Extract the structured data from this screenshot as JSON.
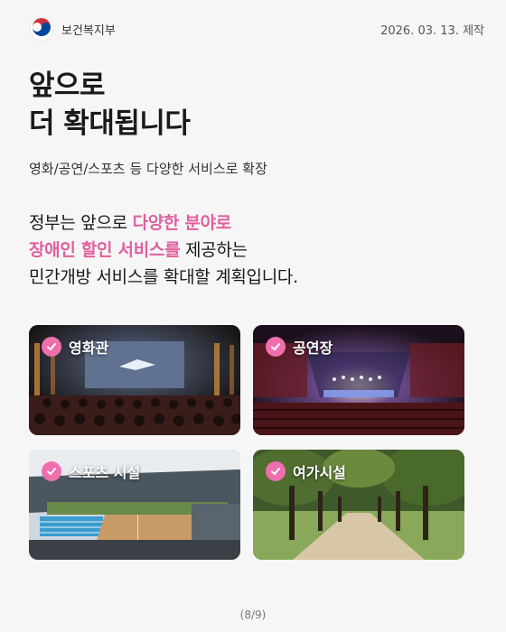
{
  "header": {
    "org_name": "보건복지부",
    "date": "2026. 03. 13. 제작",
    "logo_icon": "taegeuk-emblem-icon"
  },
  "title_lines": [
    "앞으로",
    "더 확대됩니다"
  ],
  "subtitle": "영화/공연/스포츠 등 다양한 서비스로 확장",
  "body": {
    "line1_pre": "정부는 앞으로 ",
    "line1_highlight": "다양한 분야로",
    "line2_highlight": "장애인 할인 서비스를",
    "line2_post": " 제공하는",
    "line3": "민간개방 서비스를 확대할 계획입니다."
  },
  "colors": {
    "highlight": "#e0609f",
    "check": "#ef6fae"
  },
  "cards": [
    {
      "label": "영화관",
      "icon": "check-icon"
    },
    {
      "label": "공연장",
      "icon": "check-icon"
    },
    {
      "label": "스포츠 시설",
      "icon": "check-icon"
    },
    {
      "label": "여가시설",
      "icon": "check-icon"
    }
  ],
  "footer": {
    "page": "(8/9)"
  }
}
